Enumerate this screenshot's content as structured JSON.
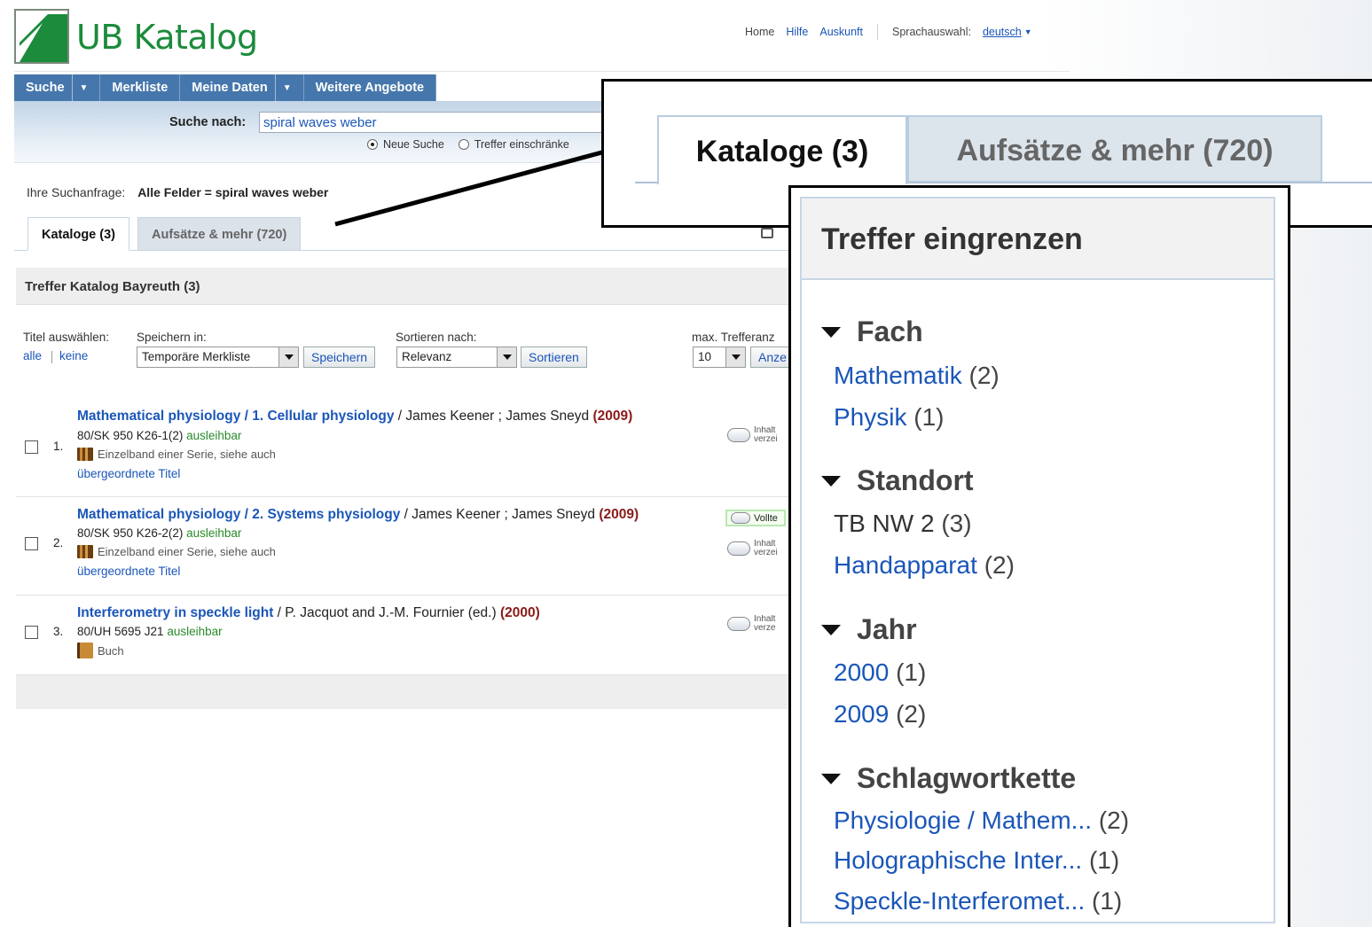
{
  "brand": {
    "title": "UB Katalog"
  },
  "toplinks": {
    "home": "Home",
    "help": "Hilfe",
    "info": "Auskunft",
    "lang_label": "Sprachauswahl:",
    "lang_value": "deutsch"
  },
  "nav": [
    {
      "label": "Suche",
      "dropdown": true
    },
    {
      "label": "Merkliste",
      "dropdown": false
    },
    {
      "label": "Meine Daten",
      "dropdown": true
    },
    {
      "label": "Weitere Angebote",
      "dropdown": false
    }
  ],
  "search": {
    "label": "Suche nach:",
    "value": "spiral waves weber",
    "radio_new": "Neue Suche",
    "radio_narrow": "Treffer einschränke"
  },
  "query": {
    "label": "Ihre Suchanfrage:",
    "value": "Alle Felder = spiral waves weber"
  },
  "tabs": {
    "catalogs": "Kataloge (3)",
    "articles": "Aufsätze & mehr (720)"
  },
  "results": {
    "title": "Treffer Katalog Bayreuth (3)",
    "select_label": "Titel auswählen:",
    "select_all": "alle",
    "select_none": "keine",
    "save_label": "Speichern in:",
    "save_value": "Temporäre Merkliste",
    "save_button": "Speichern",
    "sort_label": "Sortieren nach:",
    "sort_value": "Relevanz",
    "sort_button": "Sortieren",
    "max_label": "max. Trefferanz",
    "max_value": "10",
    "show_button": "Anze",
    "items": [
      {
        "num": "1.",
        "title": "Mathematical physiology / 1. Cellular physiology",
        "authors": " / James Keener ; James Sneyd ",
        "year": "(2009)",
        "signature": "80/SK 950 K26-1(2)",
        "status": "ausleihbar",
        "type": "Einzelband einer Serie, siehe auch",
        "parent": "übergeordnete Titel",
        "toc": "Inhalt verzei",
        "volltext": ""
      },
      {
        "num": "2.",
        "title": "Mathematical physiology / 2. Systems physiology",
        "authors": " / James Keener ; James Sneyd ",
        "year": "(2009)",
        "signature": "80/SK 950 K26-2(2)",
        "status": "ausleihbar",
        "type": "Einzelband einer Serie, siehe auch",
        "parent": "übergeordnete Titel",
        "toc": "Inhalt verzei",
        "volltext": "Vollte"
      },
      {
        "num": "3.",
        "title": "Interferometry in speckle light",
        "authors": " / P. Jacquot and J.-M. Fournier (ed.) ",
        "year": "(2000)",
        "signature": "80/UH 5695 J21",
        "status": "ausleihbar",
        "type": "Buch",
        "parent": "",
        "toc": "Inhalt verze",
        "volltext": ""
      }
    ]
  },
  "zoom_tabs": {
    "catalogs": "Kataloge (3)",
    "articles": "Aufsätze & mehr (720)"
  },
  "facets": {
    "title": "Treffer eingrenzen",
    "groups": [
      {
        "name": "Fach",
        "items": [
          {
            "label": "Mathematik",
            "count": "(2)"
          },
          {
            "label": "Physik",
            "count": "(1)"
          }
        ]
      },
      {
        "name": "Standort",
        "items": [
          {
            "label": "TB NW 2",
            "count": "(3)"
          },
          {
            "label": "Handapparat",
            "count": "(2)"
          }
        ]
      },
      {
        "name": "Jahr",
        "items": [
          {
            "label": "2000",
            "count": "(1)"
          },
          {
            "label": "2009",
            "count": "(2)"
          }
        ]
      },
      {
        "name": "Schlagwortkette",
        "items": [
          {
            "label": "Physiologie / Mathem...",
            "count": "(2)"
          },
          {
            "label": "Holographische Inter...",
            "count": "(1)"
          },
          {
            "label": "Speckle-Interferomet...",
            "count": "(1)"
          }
        ]
      }
    ]
  },
  "colors": {
    "brand_green": "#1c8b3c",
    "nav_blue": "#4677ac",
    "link_blue": "#1a56b8",
    "available_green": "#2a8a2a",
    "year_red": "#8b1a1a"
  }
}
